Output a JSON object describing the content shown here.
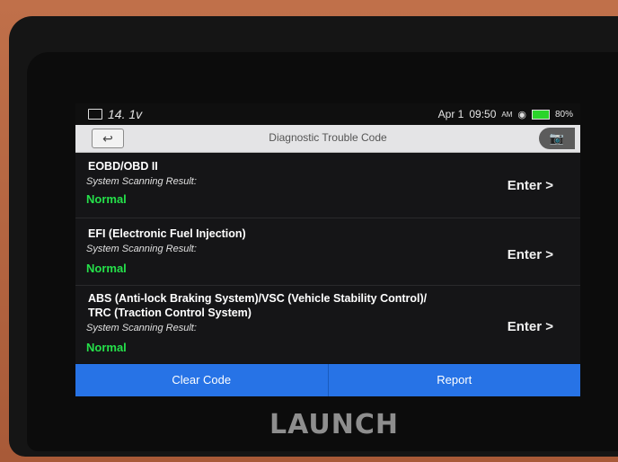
{
  "status_bar": {
    "note": "14. 1v",
    "date": "Apr 1",
    "time": "09:50",
    "ampm": "AM",
    "battery": "80%"
  },
  "header": {
    "title": "Diagnostic Trouble Code",
    "back_icon": "back-arrow-icon",
    "camera_icon": "camera-icon"
  },
  "systems": [
    {
      "name": "EOBD/OBD II",
      "result_label": "System Scanning Result:",
      "status": "Normal",
      "action": "Enter >"
    },
    {
      "name": "EFI (Electronic Fuel Injection)",
      "result_label": "System Scanning Result:",
      "status": "Normal",
      "action": "Enter >"
    },
    {
      "name_line1": "ABS (Anti-lock Braking System)/VSC (Vehicle Stability Control)/",
      "name_line2": "TRC (Traction Control System)",
      "result_label": "System Scanning Result:",
      "status": "Normal",
      "action": "Enter >"
    }
  ],
  "footer": {
    "clear_code": "Clear Code",
    "report": "Report"
  },
  "device": {
    "brand": "LAUNCH"
  },
  "colors": {
    "accent_blue": "#2773e6",
    "status_normal": "#25e04a"
  }
}
